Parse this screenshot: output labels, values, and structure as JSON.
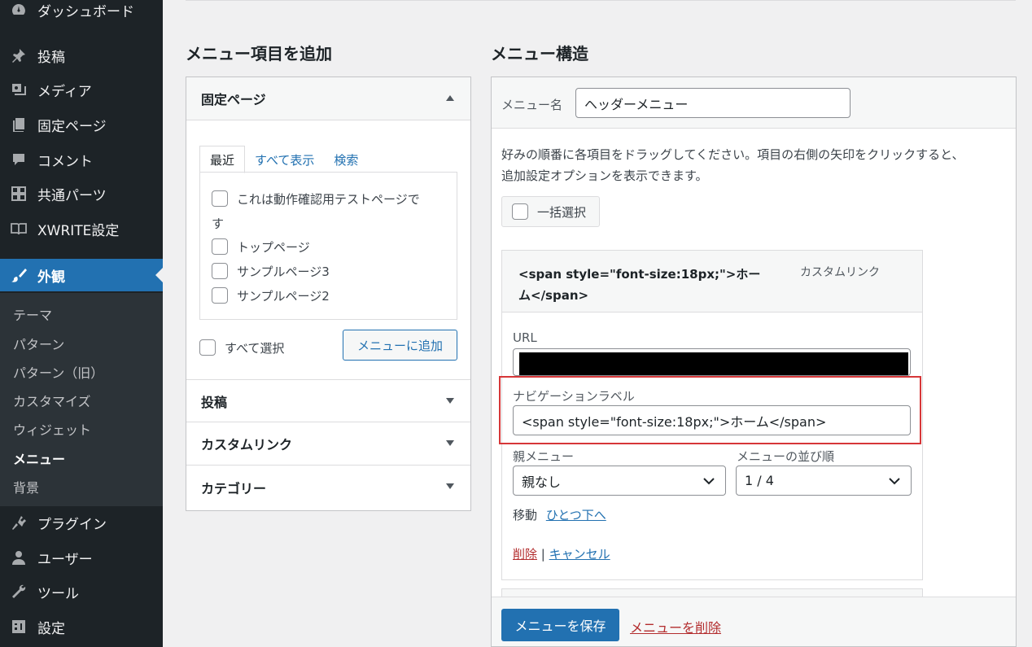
{
  "sidebar": {
    "items": [
      {
        "label": "ダッシュボード",
        "icon": "dashboard-icon"
      },
      {
        "label": "投稿",
        "icon": "pin-icon"
      },
      {
        "label": "メディア",
        "icon": "media-icon"
      },
      {
        "label": "固定ページ",
        "icon": "page-icon"
      },
      {
        "label": "コメント",
        "icon": "comment-icon"
      },
      {
        "label": "共通パーツ",
        "icon": "grid-icon"
      },
      {
        "label": "XWRITE設定",
        "icon": "book-icon"
      },
      {
        "label": "外観",
        "icon": "paintbrush-icon"
      },
      {
        "label": "プラグイン",
        "icon": "plugin-icon"
      },
      {
        "label": "ユーザー",
        "icon": "user-icon"
      },
      {
        "label": "ツール",
        "icon": "wrench-icon"
      },
      {
        "label": "設定",
        "icon": "settings-icon"
      }
    ],
    "submenu": [
      "テーマ",
      "パターン",
      "パターン（旧）",
      "カスタマイズ",
      "ウィジェット",
      "メニュー",
      "背景"
    ],
    "accent_color": "#2271b1"
  },
  "add_items": {
    "title": "メニュー項目を追加",
    "pages_section": "固定ページ",
    "tabs": [
      "最近",
      "すべて表示",
      "検索"
    ],
    "pages": [
      "これは動作確認用テストページで",
      "す",
      "トップページ",
      "サンプルページ3",
      "サンプルページ2"
    ],
    "select_all": "すべて選択",
    "add_button": "メニューに追加",
    "sections": [
      "投稿",
      "カスタムリンク",
      "カテゴリー"
    ]
  },
  "structure": {
    "title": "メニュー構造",
    "menu_name_label": "メニュー名",
    "menu_name_value": "ヘッダーメニュー",
    "instructions_line1": "好みの順番に各項目をドラッグしてください。項目の右側の矢印をクリックすると、",
    "instructions_line2": "追加設定オプションを表示できます。",
    "bulk_select": "一括選択",
    "item": {
      "title_line1": "<span style=\"font-size:18px;\">ホー",
      "title_line2": "ム</span>",
      "type": "カスタムリンク",
      "url_label": "URL",
      "nav_label_label": "ナビゲーションラベル",
      "nav_label_value": "<span style=\"font-size:18px;\">ホーム</span>",
      "parent_label": "親メニュー",
      "parent_value": "親なし",
      "order_label": "メニューの並び順",
      "order_value": "1 / 4",
      "move_label": "移動",
      "move_link": "ひとつ下へ",
      "delete": "削除",
      "separator": "|",
      "cancel": "キャンセル"
    },
    "save_button": "メニューを保存",
    "delete_menu": "メニューを削除",
    "highlight_color": "#d63638"
  }
}
